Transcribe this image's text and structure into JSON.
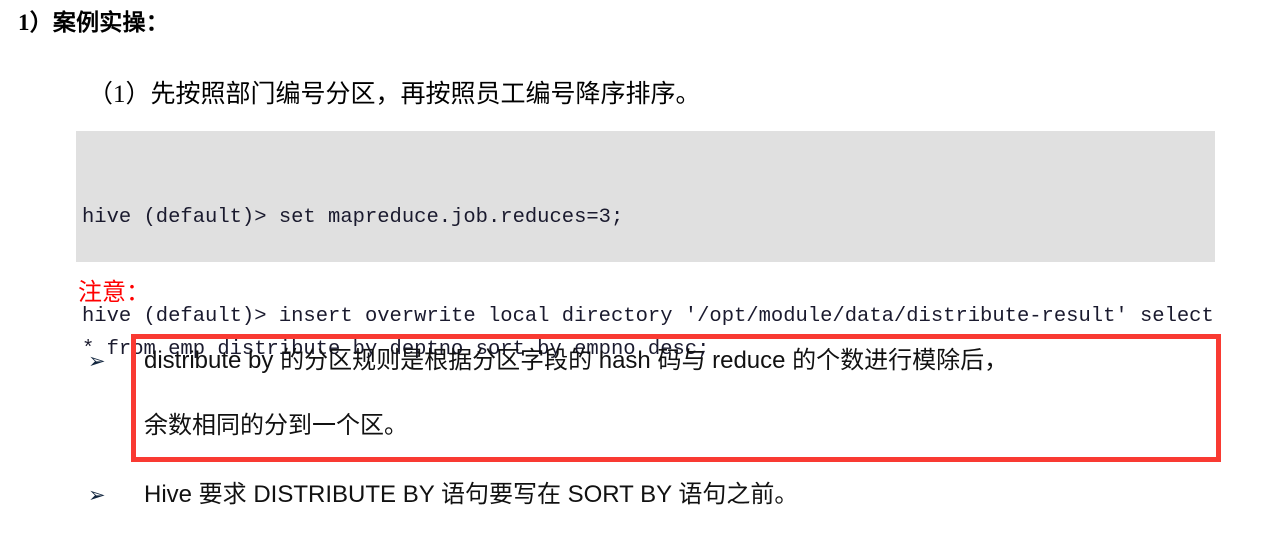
{
  "document": {
    "heading_1": "1）案例实操：",
    "heading_2": "（1）先按照部门编号分区，再按照员工编号降序排序。",
    "notice_label": "注意：",
    "code_block": {
      "lines": [
        "hive (default)> set mapreduce.job.reduces=3;",
        "hive (default)> insert overwrite local directory '/opt/module/data/distribute-result' select * from emp distribute by deptno sort by empno desc;"
      ],
      "background_color": "#e0e0e0",
      "text_color": "#1a1a2e"
    },
    "bullets": [
      {
        "marker": "➢",
        "marker_name": "arrow-bullet-icon",
        "lines": [
          "distribute by 的分区规则是根据分区字段的 hash 码与 reduce 的个数进行模除后，",
          "余数相同的分到一个区。"
        ],
        "highlighted": true
      },
      {
        "marker": "➢",
        "marker_name": "arrow-bullet-icon",
        "lines": [
          "Hive 要求 DISTRIBUTE BY 语句要写在 SORT BY 语句之前。"
        ],
        "highlighted": false
      }
    ],
    "colors": {
      "notice_red": "#ff0000",
      "highlight_box_red": "#f93a32",
      "code_background": "#e0e0e0",
      "page_background": "#ffffff"
    }
  }
}
